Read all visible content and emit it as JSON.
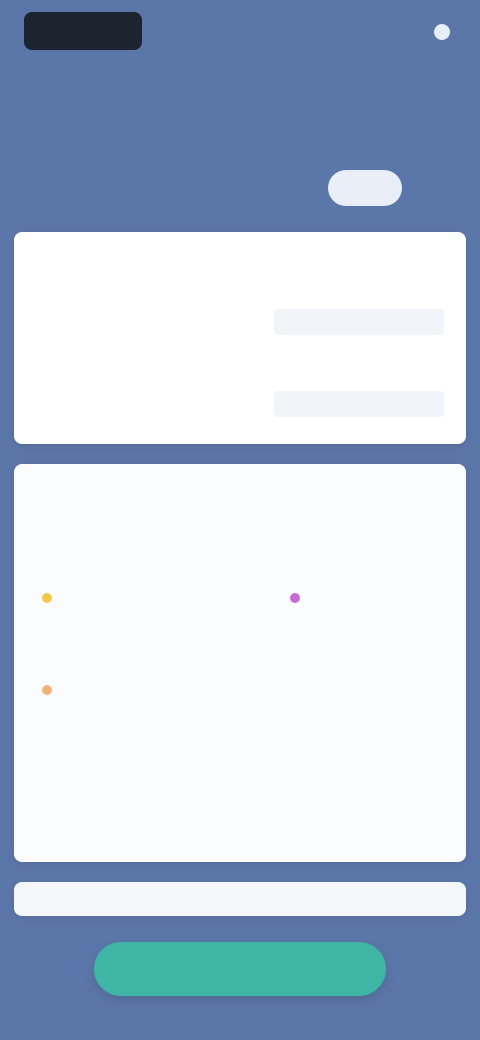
{
  "header": {
    "logo_text": "",
    "action_label": "",
    "sub_label": ""
  },
  "hero": {
    "kicker": "",
    "title": "",
    "text": "",
    "pill_label": "",
    "link_label": ""
  },
  "card1": {
    "heading": "",
    "rows": [
      {
        "label": "",
        "value": ""
      },
      {
        "label": "",
        "value": ""
      }
    ]
  },
  "card2": {
    "heading": "",
    "sections": [
      {
        "title": ""
      },
      {
        "title": ""
      },
      {
        "title": ""
      }
    ],
    "chips": [
      {
        "label": "",
        "color": "#f2c94c"
      },
      {
        "label": "",
        "color": "#c46bd6"
      },
      {
        "label": "",
        "color": "#f2b27a"
      },
      {
        "label": ""
      },
      {
        "label": ""
      },
      {
        "label": ""
      },
      {
        "label": ""
      },
      {
        "label": ""
      }
    ]
  },
  "card3": {
    "label": ""
  },
  "cta": {
    "label": ""
  },
  "colors": {
    "background": "#5b76a8",
    "card": "#ffffff",
    "accent": "#3fb5a6",
    "logo": "#1c2430"
  }
}
